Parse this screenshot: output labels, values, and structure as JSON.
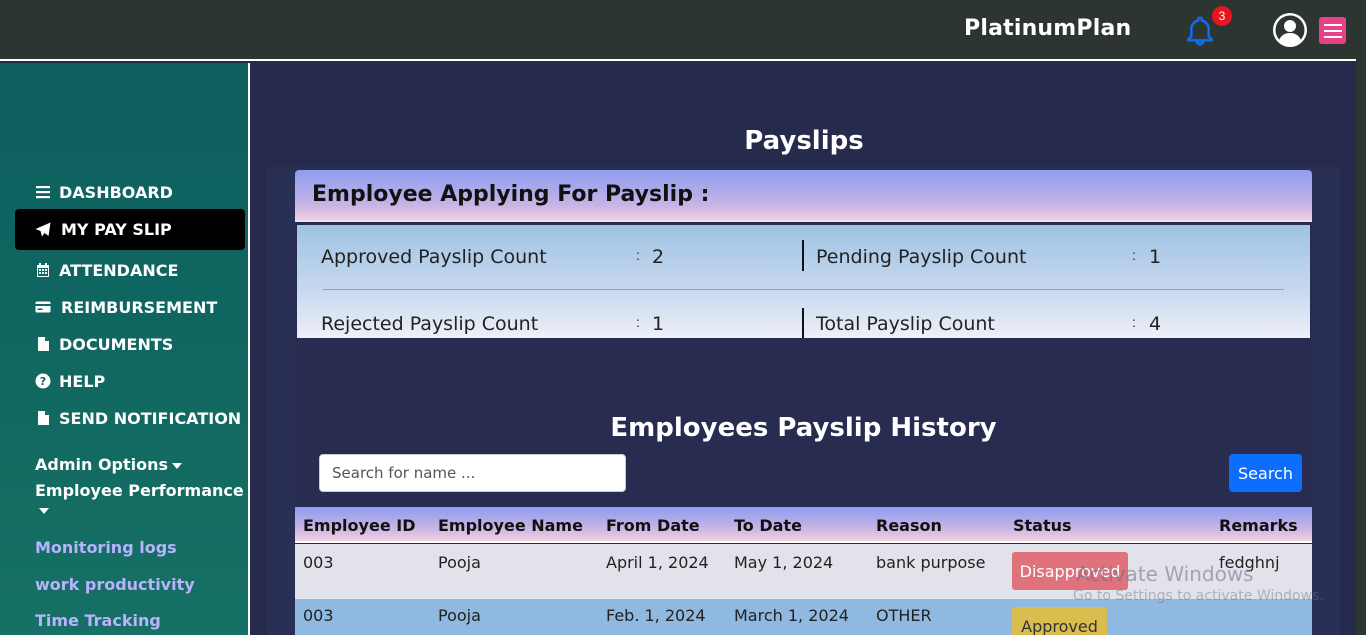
{
  "header": {
    "brand": "PlatinumPlan",
    "notification_count": "3",
    "icons": {
      "bell": "bell-icon",
      "avatar": "user-circle-icon",
      "menu": "hamburger-icon"
    },
    "colors": {
      "bell": "#0d6efd",
      "badge": "#e8141f",
      "menu": "#e8418a"
    }
  },
  "sidebar": {
    "items": [
      {
        "label": "DASHBOARD",
        "icon": "list-icon",
        "active": false
      },
      {
        "label": "MY PAY SLIP",
        "icon": "paper-plane-icon",
        "active": true
      },
      {
        "label": "ATTENDANCE",
        "icon": "calendar-icon",
        "active": false
      },
      {
        "label": "REIMBURSEMENT",
        "icon": "credit-card-icon",
        "active": false
      },
      {
        "label": "DOCUMENTS",
        "icon": "file-icon",
        "active": false
      },
      {
        "label": "HELP",
        "icon": "question-circle-icon",
        "active": false
      },
      {
        "label": "SEND NOTIFICATION",
        "icon": "file-icon",
        "active": false
      }
    ],
    "dropdowns": [
      "Admin Options",
      "Employee Performance"
    ],
    "links": [
      "Monitoring logs",
      "work productivity",
      "Time Tracking"
    ]
  },
  "main": {
    "title": "Payslips",
    "card_title": "Employee Applying For Payslip :",
    "stats": [
      {
        "label": "Approved Payslip Count",
        "value": "2"
      },
      {
        "label": "Pending Payslip Count",
        "value": "1"
      },
      {
        "label": "Rejected Payslip Count",
        "value": "1"
      },
      {
        "label": "Total Payslip Count",
        "value": "4"
      }
    ],
    "colon": ":",
    "history_title": "Employees Payslip History",
    "search": {
      "placeholder": "Search for name ...",
      "button": "Search"
    },
    "table": {
      "headers": [
        "Employee ID",
        "Employee Name",
        "From Date",
        "To Date",
        "Reason",
        "Status",
        "Remarks"
      ],
      "rows": [
        {
          "id": "003",
          "name": "Pooja",
          "from": "April 1, 2024",
          "to": "May 1, 2024",
          "reason": "bank purpose",
          "status": "Disapproved",
          "remarks": "fedghnj"
        },
        {
          "id": "003",
          "name": "Pooja",
          "from": "Feb. 1, 2024",
          "to": "March 1, 2024",
          "reason": "OTHER",
          "status": "Approved",
          "remarks": ""
        }
      ],
      "status_colors": {
        "Disapproved": "#e0727b",
        "Approved": "#d9bd4e"
      },
      "row_colors": [
        "#e2e3ea",
        "#8fb9e0"
      ]
    }
  },
  "watermark": {
    "line1": "Activate Windows",
    "line2": "Go to Settings to activate Windows."
  }
}
